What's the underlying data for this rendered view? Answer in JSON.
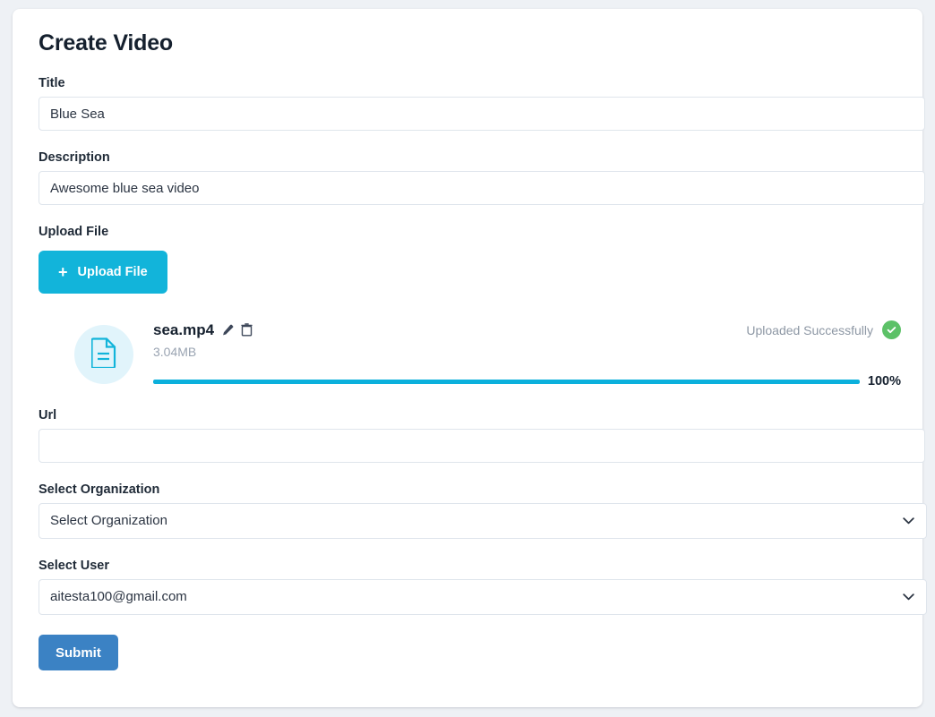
{
  "page": {
    "title": "Create Video"
  },
  "form": {
    "title_field": {
      "label": "Title",
      "value": "Blue Sea",
      "placeholder": ""
    },
    "description_field": {
      "label": "Description",
      "value": "Awesome blue sea video",
      "placeholder": ""
    },
    "upload_field": {
      "label": "Upload File",
      "button_label": "Upload File",
      "plus": "+"
    },
    "url_field": {
      "label": "Url",
      "value": "",
      "placeholder": ""
    },
    "organization_field": {
      "label": "Select Organization",
      "value": "Select Organization"
    },
    "user_field": {
      "label": "Select User",
      "value": "aitesta100@gmail.com"
    },
    "submit_label": "Submit"
  },
  "uploaded_file": {
    "name": "sea.mp4",
    "size": "3.04MB",
    "status_text": "Uploaded Successfully",
    "progress_percent_label": "100%",
    "progress_value": 100,
    "icons": {
      "file": "file-document-icon",
      "edit": "pencil-icon",
      "delete": "trash-icon",
      "success": "check-circle-icon"
    }
  },
  "colors": {
    "background": "#eef1f5",
    "card": "#ffffff",
    "accent_cyan": "#12b4da",
    "progress_cyan": "#0bb0dc",
    "success_green": "#5cc167",
    "submit_blue": "#3b82c4",
    "file_thumb_bg": "#e1f4fb",
    "border": "#dfe5ec",
    "heading": "#15202e",
    "muted_text": "#9aa4b2"
  }
}
